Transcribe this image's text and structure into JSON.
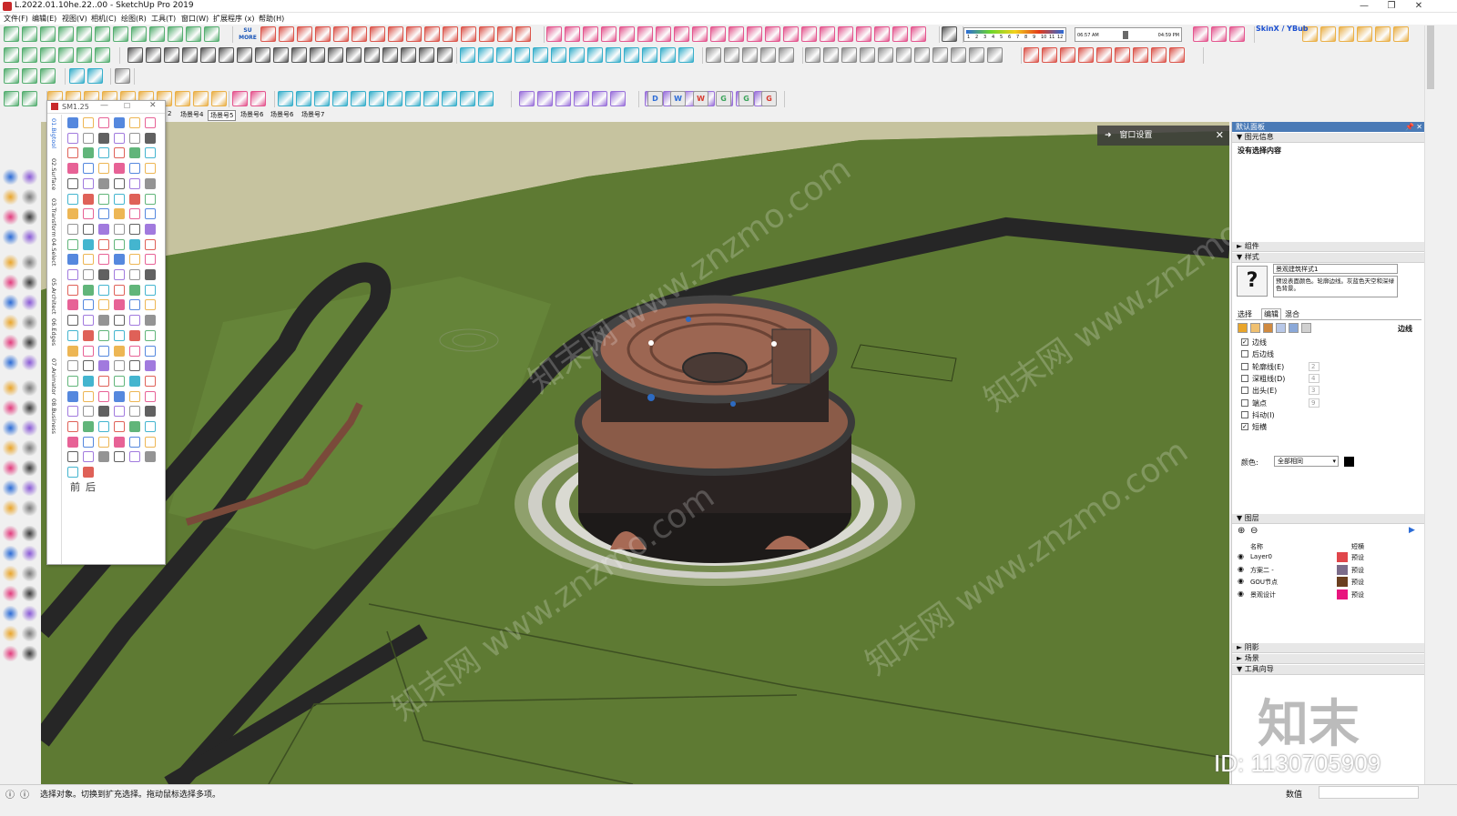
{
  "window": {
    "title": "L.2022.01.10he.22..00 - SketchUp Pro 2019",
    "controls": [
      "—",
      "❐",
      "✕"
    ]
  },
  "menu": {
    "items": [
      "文件(F)",
      "编辑(E)",
      "视图(V)",
      "相机(C)",
      "绘图(R)",
      "工具(T)",
      "窗口(W)",
      "扩展程序 (x)",
      "帮助(H)"
    ]
  },
  "toolbar": {
    "su_more_label": "SU MORE",
    "skinx_label": "SkinX / YBub",
    "shadow_time_start": "06:57 AM",
    "shadow_time_end": "04:59 PM",
    "month_ticks": [
      "1",
      "2",
      "3",
      "4",
      "5",
      "6",
      "7",
      "8",
      "9",
      "10",
      "11",
      "12"
    ],
    "letter_buttons": [
      "D",
      "W",
      "W",
      "G",
      "G",
      "G"
    ]
  },
  "scene_tabs": [
    "2",
    "场景号4",
    "场景号5",
    "场景号6",
    "场景号6",
    "场景号7"
  ],
  "plugin_panel": {
    "title": "SM1.25",
    "vertical_tabs": [
      "01.Bigtool",
      "02.Surface",
      "03.Transform",
      "04.Select",
      "05.Architect",
      "06.Edges",
      "07.Animator",
      "08.Business"
    ],
    "footer_chars": [
      "前",
      "后"
    ]
  },
  "viewport": {
    "window_settings_label": "窗口设置",
    "watermark_text": "知末网 www.znzmo.com"
  },
  "tray": {
    "title": "默认面板",
    "entity_info": {
      "header": "图元信息",
      "empty_text": "没有选择内容"
    },
    "components_header": "组件",
    "styles": {
      "header": "样式",
      "style_name": "景观建筑样式1",
      "style_desc": "预设表面颜色。轮廓边线。灰蓝色天空和深绿色背景。",
      "tabs": [
        "选择",
        "编辑",
        "混合"
      ],
      "edges_label": "边线",
      "options": [
        {
          "label": "边线",
          "checked": true,
          "value": ""
        },
        {
          "label": "后边线",
          "checked": false,
          "value": ""
        },
        {
          "label": "轮廓线(E)",
          "checked": false,
          "value": "2"
        },
        {
          "label": "深粗线(D)",
          "checked": false,
          "value": "4"
        },
        {
          "label": "出头(E)",
          "checked": false,
          "value": "3"
        },
        {
          "label": "端点",
          "checked": false,
          "value": "9"
        },
        {
          "label": "抖动(I)",
          "checked": false,
          "value": ""
        },
        {
          "label": "短横",
          "checked": true,
          "value": ""
        }
      ],
      "color_label": "颜色:",
      "color_value": "全部相同"
    },
    "layers": {
      "header": "图层",
      "col_name": "名称",
      "col_dash": "短横",
      "rows": [
        {
          "name": "Layer0",
          "color": "#e0464b",
          "dash": "预设"
        },
        {
          "name": "方案二 -",
          "color": "#7b6c8a",
          "dash": "预设"
        },
        {
          "name": "GOU节点",
          "color": "#6b3f1f",
          "dash": "预设"
        },
        {
          "name": "景观设计",
          "color": "#e8157e",
          "dash": "预设"
        }
      ]
    },
    "shadow_header": "阴影",
    "scenes_header": "场景",
    "instructor_header": "工具向导"
  },
  "brand": {
    "logo_text": "知末",
    "id_text": "ID: 1130705909"
  },
  "status": {
    "message": "选择对象。切换到扩充选择。拖动鼠标选择多项。",
    "measure_label": "数值"
  }
}
